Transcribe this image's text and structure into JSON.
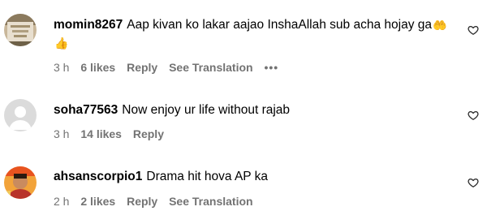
{
  "comments": [
    {
      "username": "momin8267",
      "text": "Aap kivan ko lakar aajao InshaAllah sub acha hojay ga",
      "emojis": [
        "🤲",
        "👍"
      ],
      "time": "3 h",
      "likes": "6 likes",
      "reply": "Reply",
      "translation": "See Translation",
      "more": "•••",
      "avatar_icon": "profile-photo"
    },
    {
      "username": "soha77563",
      "text": "Now enjoy ur life without rajab",
      "time": "3 h",
      "likes": "14 likes",
      "reply": "Reply",
      "avatar_icon": "default-avatar"
    },
    {
      "username": "ahsanscorpio1",
      "text": "Drama hit hova AP ka",
      "time": "2 h",
      "likes": "2 likes",
      "reply": "Reply",
      "translation": "See Translation",
      "avatar_icon": "profile-photo"
    }
  ],
  "colors": {
    "meta_text": "#737373",
    "default_avatar_bg": "#dbdbdb"
  }
}
